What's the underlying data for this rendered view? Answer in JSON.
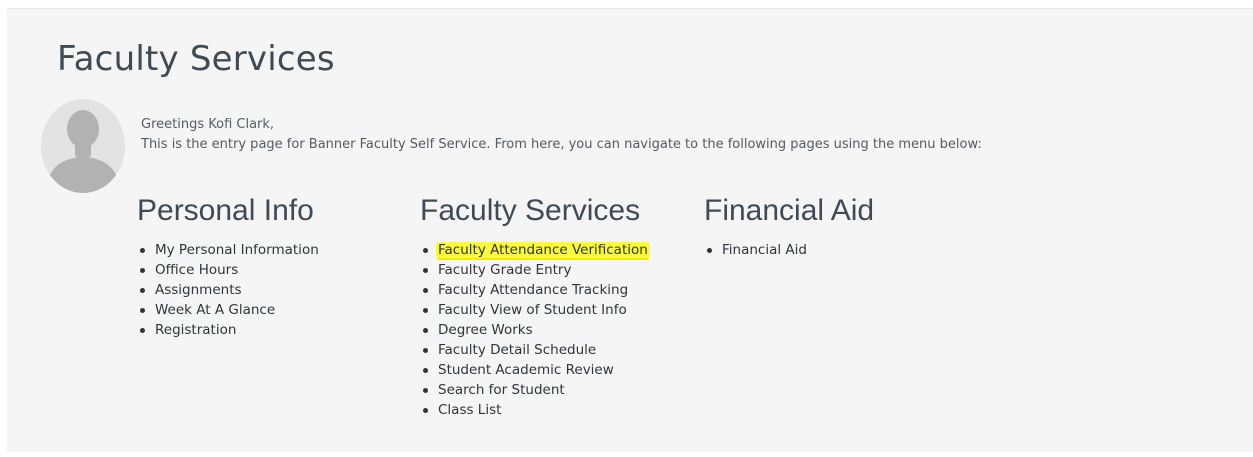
{
  "page": {
    "title": "Faculty Services"
  },
  "greeting": {
    "line1": "Greetings Kofi Clark,",
    "line2": "This is the entry page for Banner Faculty Self Service. From here, you can navigate to the following pages using the menu below:"
  },
  "avatar": {
    "icon": "user-silhouette-icon"
  },
  "sections": {
    "personal": {
      "heading": "Personal Info",
      "items": [
        "My Personal Information",
        "Office Hours",
        "Assignments",
        "Week At A Glance",
        "Registration"
      ]
    },
    "faculty": {
      "heading": "Faculty Services",
      "items": [
        "Faculty Attendance Verification",
        "Faculty Grade Entry",
        "Faculty Attendance Tracking",
        "Faculty View of Student Info",
        "Degree Works",
        "Faculty Detail Schedule",
        "Student Academic Review",
        "Search for Student",
        "Class List"
      ],
      "highlighted_item": "Faculty Attendance Verification"
    },
    "aid": {
      "heading": "Financial Aid",
      "items": [
        "Financial Aid"
      ]
    }
  },
  "colors": {
    "highlight": "#fbfb3a",
    "panel_background": "#f5f5f5",
    "heading": "#3f4a55"
  }
}
